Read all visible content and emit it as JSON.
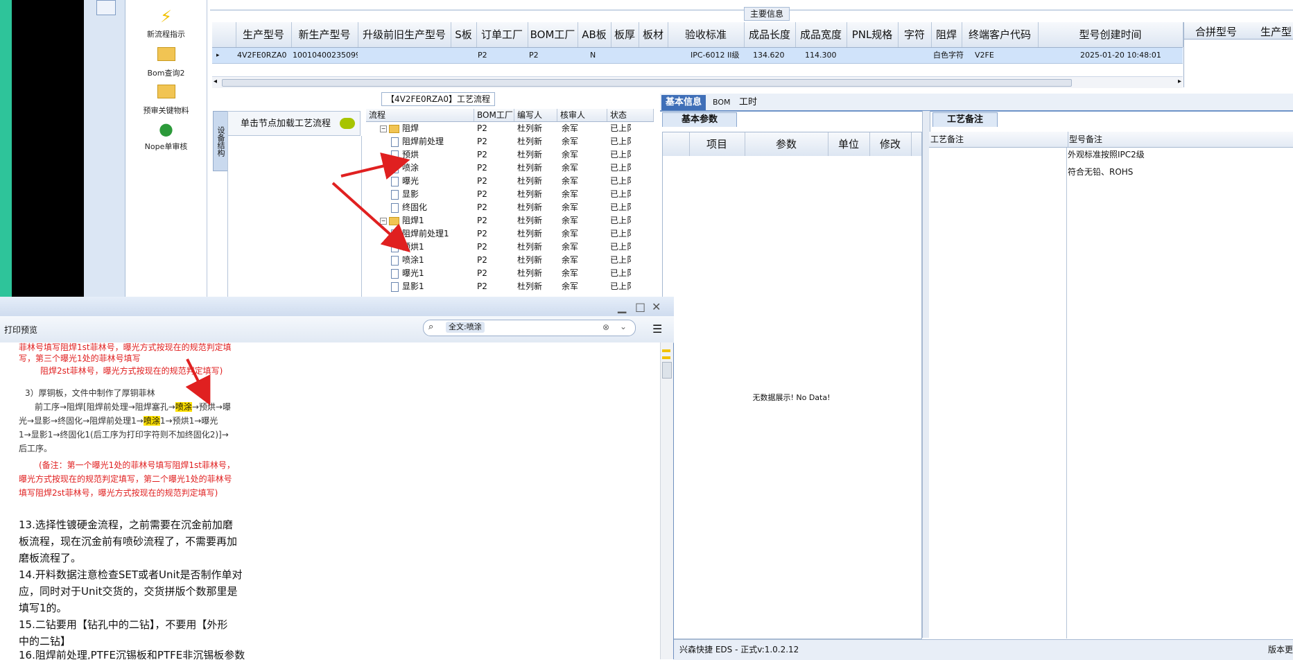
{
  "nav": {
    "items": [
      {
        "label": "新流程指示",
        "icon": "lightning-icon"
      },
      {
        "label": "Bom查询2",
        "icon": "folder-icon"
      },
      {
        "label": "预审关键物料",
        "icon": "folder-icon"
      },
      {
        "label": "Nope单审核",
        "icon": "user-icon"
      }
    ]
  },
  "main_info": {
    "title": "主要信息",
    "columns": [
      "生产型号",
      "新生产型号",
      "升级前旧生产型号",
      "S板",
      "订单工厂",
      "BOM工厂",
      "AB板",
      "板厚",
      "板材",
      "验收标准",
      "成品长度",
      "成品宽度",
      "PNL规格",
      "字符",
      "阻焊",
      "终端客户代码",
      "型号创建时间"
    ],
    "row": {
      "model": "4V2FE0RZA0",
      "new_model": "10010400235099",
      "order_factory": "P2",
      "bom_factory": "P2",
      "ab": "N",
      "standard": "IPC-6012 II级",
      "length": "134.620",
      "width": "114.300",
      "char": "白色字符",
      "customer": "V2FE",
      "created": "2025-01-20 10:48:01"
    },
    "merge_columns": [
      "合拼型号",
      "生产型"
    ]
  },
  "flow": {
    "title": "【4V2FE0RZA0】工艺流程",
    "side_tab": "设备结构",
    "hint": "单击节点加载工艺流程",
    "columns": [
      "流程",
      "BOM工厂",
      "编写人",
      "核审人",
      "状态"
    ],
    "rows": [
      {
        "name": "阻焊",
        "factory": "P2",
        "writer": "杜列新",
        "reviewer": "余军",
        "status": "已上阝",
        "folder": true
      },
      {
        "name": "阻焊前处理",
        "factory": "P2",
        "writer": "杜列新",
        "reviewer": "余军",
        "status": "已上阝",
        "folder": false
      },
      {
        "name": "预烘",
        "factory": "P2",
        "writer": "杜列新",
        "reviewer": "余军",
        "status": "已上阝",
        "folder": false
      },
      {
        "name": "喷涂",
        "factory": "P2",
        "writer": "杜列新",
        "reviewer": "余军",
        "status": "已上阝",
        "folder": false
      },
      {
        "name": "曝光",
        "factory": "P2",
        "writer": "杜列新",
        "reviewer": "余军",
        "status": "已上阝",
        "folder": false
      },
      {
        "name": "显影",
        "factory": "P2",
        "writer": "杜列新",
        "reviewer": "余军",
        "status": "已上阝",
        "folder": false
      },
      {
        "name": "终固化",
        "factory": "P2",
        "writer": "杜列新",
        "reviewer": "余军",
        "status": "已上阝",
        "folder": false
      },
      {
        "name": "阻焊1",
        "factory": "P2",
        "writer": "杜列新",
        "reviewer": "余军",
        "status": "已上阝",
        "folder": true
      },
      {
        "name": "阻焊前处理1",
        "factory": "P2",
        "writer": "杜列新",
        "reviewer": "余军",
        "status": "已上阝",
        "folder": false
      },
      {
        "name": "预烘1",
        "factory": "P2",
        "writer": "杜列新",
        "reviewer": "余军",
        "status": "已上阝",
        "folder": false
      },
      {
        "name": "喷涂1",
        "factory": "P2",
        "writer": "杜列新",
        "reviewer": "余军",
        "status": "已上阝",
        "folder": false
      },
      {
        "name": "曝光1",
        "factory": "P2",
        "writer": "杜列新",
        "reviewer": "余军",
        "status": "已上阝",
        "folder": false
      },
      {
        "name": "显影1",
        "factory": "P2",
        "writer": "杜列新",
        "reviewer": "余军",
        "status": "已上阝",
        "folder": false
      }
    ]
  },
  "right": {
    "tabs": [
      "基本信息",
      "BOM",
      "工时"
    ],
    "basic_param_tab": "基本参数",
    "craft_tab": "工艺备注",
    "param_columns": [
      "项目",
      "参数",
      "单位",
      "修改"
    ],
    "no_data": "无数据展示! No Data!",
    "craft_columns": [
      "工艺备注",
      "型号备注"
    ],
    "notes": [
      "外观标准按照IPC2级",
      "符合无铅、ROHS"
    ]
  },
  "status": {
    "left": "兴森快捷 EDS - 正式v:1.0.2.12",
    "right": "版本更"
  },
  "preview": {
    "title": "打印预览",
    "search_tag": "全文:喷涂",
    "lines": {
      "l1": "菲林号填写阻焊1st菲林号，曝光方式按现在的规范判定填",
      "l2": "写，第三个曝光1处的菲林号填写",
      "l3": "阻焊2st菲林号，曝光方式按现在的规范判定填写)",
      "l4": "3）厚铜板，文件中制作了厚铜菲林",
      "l5a": "前工序→阻焊[阻焊前处理→阻焊塞孔→",
      "hl1": "喷涂",
      "l5b": "→预烘→曝",
      "l6a": "光→显影→终固化→阻焊前处理1→",
      "hl2": "喷涂",
      "l6b": "1→预烘1→曝光",
      "l7": "1→显影1→终固化1(后工序为打印字符则不加终固化2)]→",
      "l8": "后工序。",
      "l9": "(备注：第一个曝光1处的菲林号填写阻焊1st菲林号，",
      "l10": "曝光方式按现在的规范判定填写，第二个曝光1处的菲林号",
      "l11": "填写阻焊2st菲林号，曝光方式按现在的规范判定填写)",
      "l12": "13.选择性镀硬金流程，之前需要在沉金前加磨",
      "l13": "板流程，现在沉金前有喷砂流程了，不需要再加",
      "l14": "磨板流程了。",
      "l15": "14.开料数据注意检查SET或者Unit是否制作单对",
      "l16": "应，同时对于Unit交货的，交货拼版个数那里是",
      "l17": "填写1的。",
      "l18": "15.二钻要用【钻孔中的二钻】，不要用【外形",
      "l19": "中的二钻】",
      "l20": "16.阻焊前处理,PTFE沉锡板和PTFE非沉锡板参数"
    }
  },
  "colors": {
    "accent": "#3f6fb8",
    "highlight": "#ffe100",
    "annotation_red": "#e02020",
    "selected_row": "#d0e3fa"
  }
}
